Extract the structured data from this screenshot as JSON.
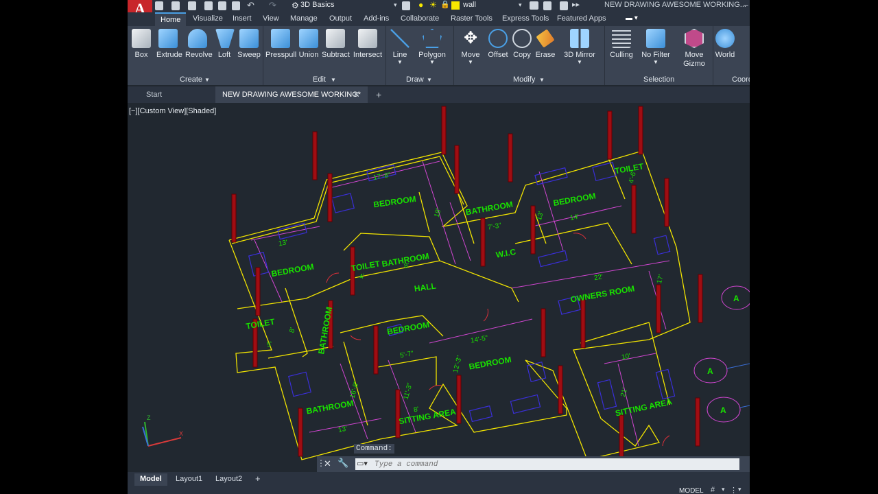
{
  "app": {
    "workspace": "3D Basics",
    "layer": "wall",
    "title": "NEW DRAWING AWESOME WORKING..."
  },
  "ribbon_tabs": [
    "Home",
    "Visualize",
    "Insert",
    "View",
    "Manage",
    "Output",
    "Add-ins",
    "Collaborate",
    "Raster Tools",
    "Express Tools",
    "Featured Apps"
  ],
  "ribbon": {
    "create": {
      "label": "Create",
      "tools": [
        "Box",
        "Extrude",
        "Revolve",
        "Loft",
        "Sweep"
      ]
    },
    "edit": {
      "label": "Edit",
      "tools": [
        "Presspull",
        "Union",
        "Subtract",
        "Intersect"
      ]
    },
    "draw": {
      "label": "Draw",
      "tools": [
        "Line",
        "Polygon"
      ]
    },
    "modify": {
      "label": "Modify",
      "tools": [
        "Move",
        "Offset",
        "Copy",
        "Erase",
        "3D Mirror"
      ]
    },
    "selection": {
      "label": "Selection",
      "tools": [
        "Culling",
        "No Filter",
        "Move Gizmo"
      ]
    },
    "coord": {
      "label": "Coord",
      "tools": [
        "World"
      ]
    }
  },
  "file_tabs": {
    "start": "Start",
    "active": "NEW DRAWING AWESOME WORKING*"
  },
  "viewport_label": "[−][Custom View][Shaded]",
  "rooms": [
    "BEDROOM",
    "BATHROOM",
    "BEDROOM",
    "TOILET",
    "BEDROOM",
    "TOILET",
    "BATHROOM",
    "HALL",
    "W.I.C",
    "OWNERS ROOM",
    "TOILET",
    "BATHROOM",
    "BEDROOM",
    "BEDROOM",
    "BATHROOM",
    "SITTING AREA"
  ],
  "dimensions": [
    "17'-8\"",
    "18'",
    "13'",
    "7'-3\"",
    "14'",
    "4'-6\"",
    "13'",
    "8'",
    "4'",
    "22'",
    "17'",
    "8'",
    "5'",
    "14'-5\"",
    "5'-7\"",
    "16'-8\"",
    "13'",
    "8'",
    "10'",
    "21'",
    "11'-3\"",
    "12'-3\""
  ],
  "grid_markers": [
    "A",
    "A",
    "A"
  ],
  "command": {
    "tag": "Command:",
    "placeholder": "Type a command"
  },
  "layouts": [
    "Model",
    "Layout1",
    "Layout2"
  ],
  "status_indicator": "MODEL"
}
